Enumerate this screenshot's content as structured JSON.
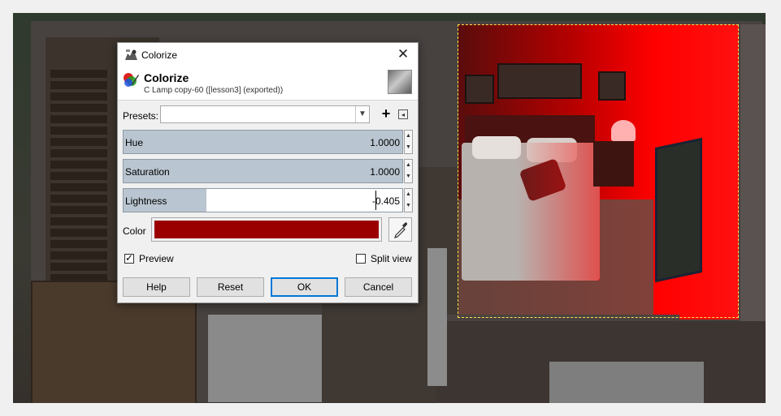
{
  "dialog": {
    "window_title": "Colorize",
    "close_glyph": "✕",
    "header_title": "Colorize",
    "header_subtitle": "C Lamp copy-60 ([lesson3] (exported))",
    "presets_label": "Presets:",
    "presets_value": "",
    "add_preset_glyph": "+",
    "sliders": [
      {
        "label": "Hue",
        "value": "1.0000",
        "fill_fraction": 1.0
      },
      {
        "label": "Saturation",
        "value": "1.0000",
        "fill_fraction": 1.0
      },
      {
        "label": "Lightness",
        "value": "-0.405",
        "fill_fraction": 0.297
      }
    ],
    "color_label": "Color",
    "color_value": "#9a0000",
    "preview_label": "Preview",
    "preview_checked": true,
    "split_view_label": "Split view",
    "split_view_checked": false,
    "buttons": {
      "help": "Help",
      "reset": "Reset",
      "ok": "OK",
      "cancel": "Cancel"
    }
  },
  "icons": {
    "title_icon": "gimp-wilber-icon",
    "header_icon": "colorize-icon",
    "picker_icon": "eyedropper-icon",
    "menu_icon": "preset-menu-icon"
  },
  "colors": {
    "accent": "#0078d7",
    "slider_fill": "#b9c5d0",
    "selection_outline": "#ffe34a",
    "colorize_red": "#ff0000"
  }
}
